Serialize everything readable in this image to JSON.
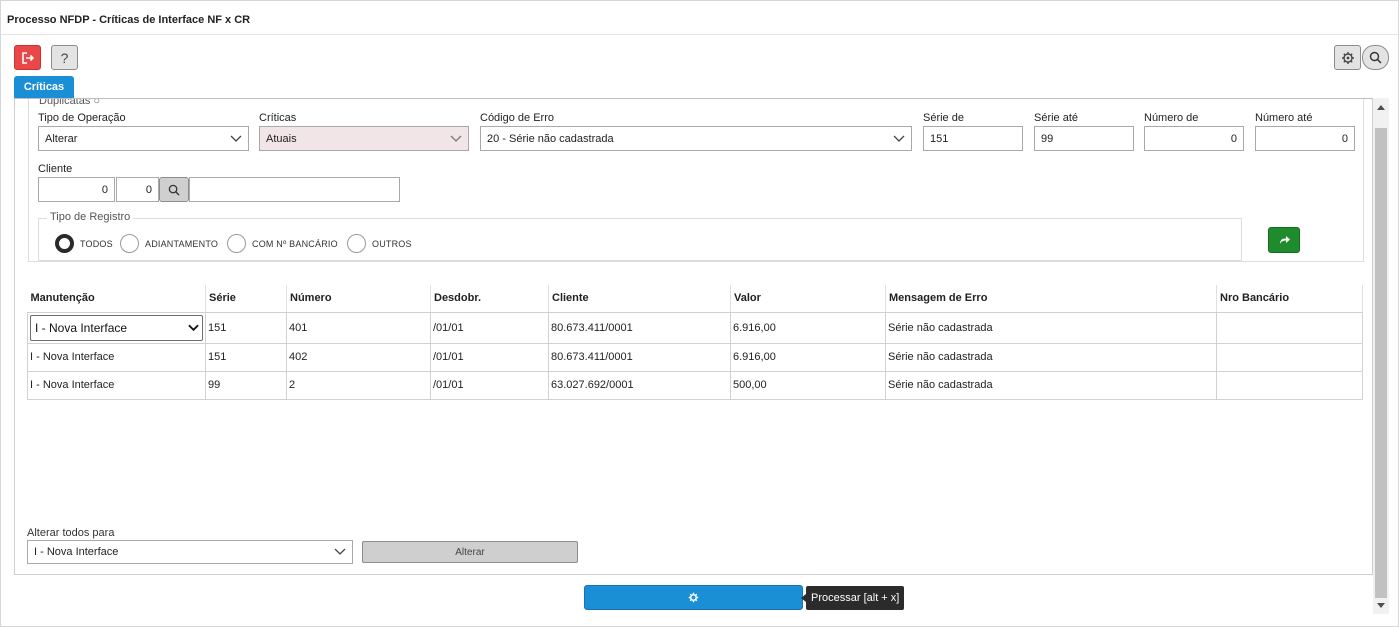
{
  "window": {
    "title": "Processo NFDP - Críticas de Interface NF x CR"
  },
  "toolbar": {
    "help_label": "?"
  },
  "tabs": [
    {
      "label": "Críticas"
    }
  ],
  "filters": {
    "duplicatas_label": "Duplicatas",
    "tipo_operacao": {
      "label": "Tipo de Operação",
      "value": "Alterar"
    },
    "criticas": {
      "label": "Críticas",
      "value": "Atuais"
    },
    "codigo_erro": {
      "label": "Código de Erro",
      "value": "20 - Série não cadastrada"
    },
    "serie_de": {
      "label": "Série de",
      "value": "151"
    },
    "serie_ate": {
      "label": "Série até",
      "value": "99"
    },
    "numero_de": {
      "label": "Número de",
      "value": "0"
    },
    "numero_ate": {
      "label": "Número até",
      "value": "0"
    },
    "cliente": {
      "label": "Cliente",
      "code1": "0",
      "code2": "0",
      "name": ""
    },
    "tipo_registro": {
      "legend": "Tipo de Registro",
      "options": [
        "TODOS",
        "ADIANTAMENTO",
        "COM Nº BANCÁRIO",
        "OUTROS"
      ],
      "selected": "TODOS"
    }
  },
  "table": {
    "headers": [
      "Manutenção",
      "Série",
      "Número",
      "Desdobr.",
      "Cliente",
      "Valor",
      "Mensagem de Erro",
      "Nro Bancário"
    ],
    "rows": [
      {
        "manutencao": "I - Nova Interface",
        "serie": "151",
        "numero": "401",
        "desdobr": "/01/01",
        "cliente": "80.673.411/0001",
        "valor": "6.916,00",
        "mensagem": "Série não cadastrada",
        "nro_bancario": ""
      },
      {
        "manutencao": "I - Nova Interface",
        "serie": "151",
        "numero": "402",
        "desdobr": "/01/01",
        "cliente": "80.673.411/0001",
        "valor": "6.916,00",
        "mensagem": "Série não cadastrada",
        "nro_bancario": ""
      },
      {
        "manutencao": "I - Nova Interface",
        "serie": "99",
        "numero": "2",
        "desdobr": "/01/01",
        "cliente": "63.027.692/0001",
        "valor": "500,00",
        "mensagem": "Série não cadastrada",
        "nro_bancario": ""
      }
    ]
  },
  "bulk": {
    "label": "Alterar todos para",
    "value": "I - Nova Interface",
    "button_label": "Alterar"
  },
  "footer": {
    "process_tooltip": "Processar [alt + x]"
  },
  "colors": {
    "accent": "#1a8fd6",
    "danger": "#ea4848",
    "success": "#1e8b2c"
  }
}
